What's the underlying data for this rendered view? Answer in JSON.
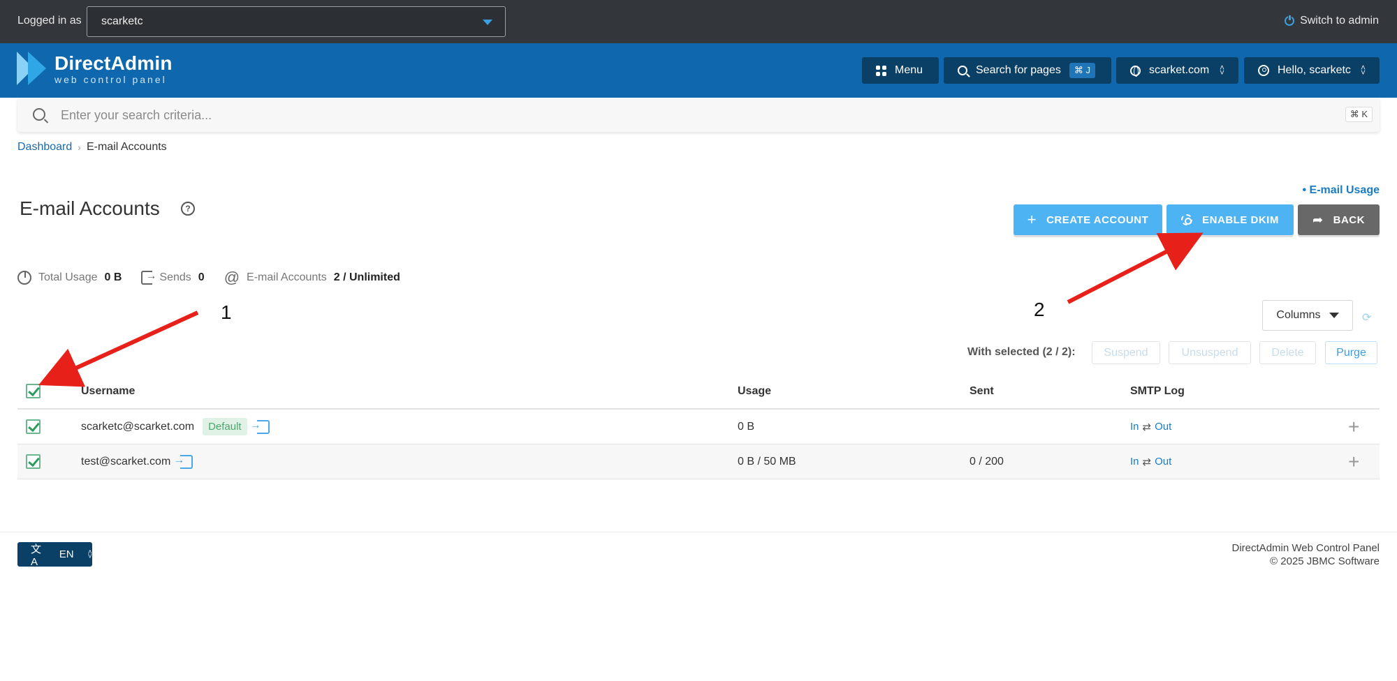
{
  "topbar": {
    "logged_label": "Logged in as",
    "user_value": "scarketc",
    "switch_label": "Switch to admin"
  },
  "header": {
    "logo_name": "DirectAdmin",
    "logo_sub": "web control panel",
    "menu_label": "Menu",
    "search_label": "Search for pages",
    "search_kbd": "⌘ J",
    "domain_label": "scarket.com",
    "hello_label": "Hello, scarketc"
  },
  "search": {
    "placeholder": "Enter your search criteria...",
    "kbd": "⌘ K"
  },
  "breadcrumb": {
    "home": "Dashboard",
    "current": "E-mail Accounts"
  },
  "page": {
    "title": "E-mail Accounts",
    "email_usage_link": "• E-mail Usage",
    "create_label": "CREATE ACCOUNT",
    "dkim_label": "ENABLE DKIM",
    "back_label": "BACK"
  },
  "stats": {
    "total_usage_label": "Total Usage",
    "total_usage_value": "0 B",
    "sends_label": "Sends",
    "sends_value": "0",
    "accounts_label": "E-mail Accounts",
    "accounts_value": "2 / Unlimited"
  },
  "annotations": {
    "label_1": "1",
    "label_2": "2",
    "arrow_color": "#e8201a"
  },
  "toolbar": {
    "columns_label": "Columns",
    "with_selected": "With selected (2 / 2):",
    "suspend": "Suspend",
    "unsuspend": "Unsuspend",
    "delete": "Delete",
    "purge": "Purge"
  },
  "table": {
    "headers": [
      "Username",
      "Usage",
      "Sent",
      "SMTP Log"
    ],
    "rows": [
      {
        "username": "scarketc@scarket.com",
        "badge": "Default",
        "usage": "0 B",
        "sent": "",
        "smtp_in": "In",
        "smtp_arrow": "⇄",
        "smtp_out": "Out"
      },
      {
        "username": "test@scarket.com",
        "badge": "",
        "usage": "0 B / 50 MB",
        "sent": "0 / 200",
        "smtp_in": "In",
        "smtp_arrow": "⇄",
        "smtp_out": "Out"
      }
    ]
  },
  "footer": {
    "lang": "EN",
    "line1": "DirectAdmin Web Control Panel",
    "line2": "© 2025 JBMC Software"
  },
  "colors": {
    "topbar": "#33363b",
    "header": "#0f68ad",
    "accent": "#4db3f2",
    "dark_button": "#0a3f66"
  }
}
